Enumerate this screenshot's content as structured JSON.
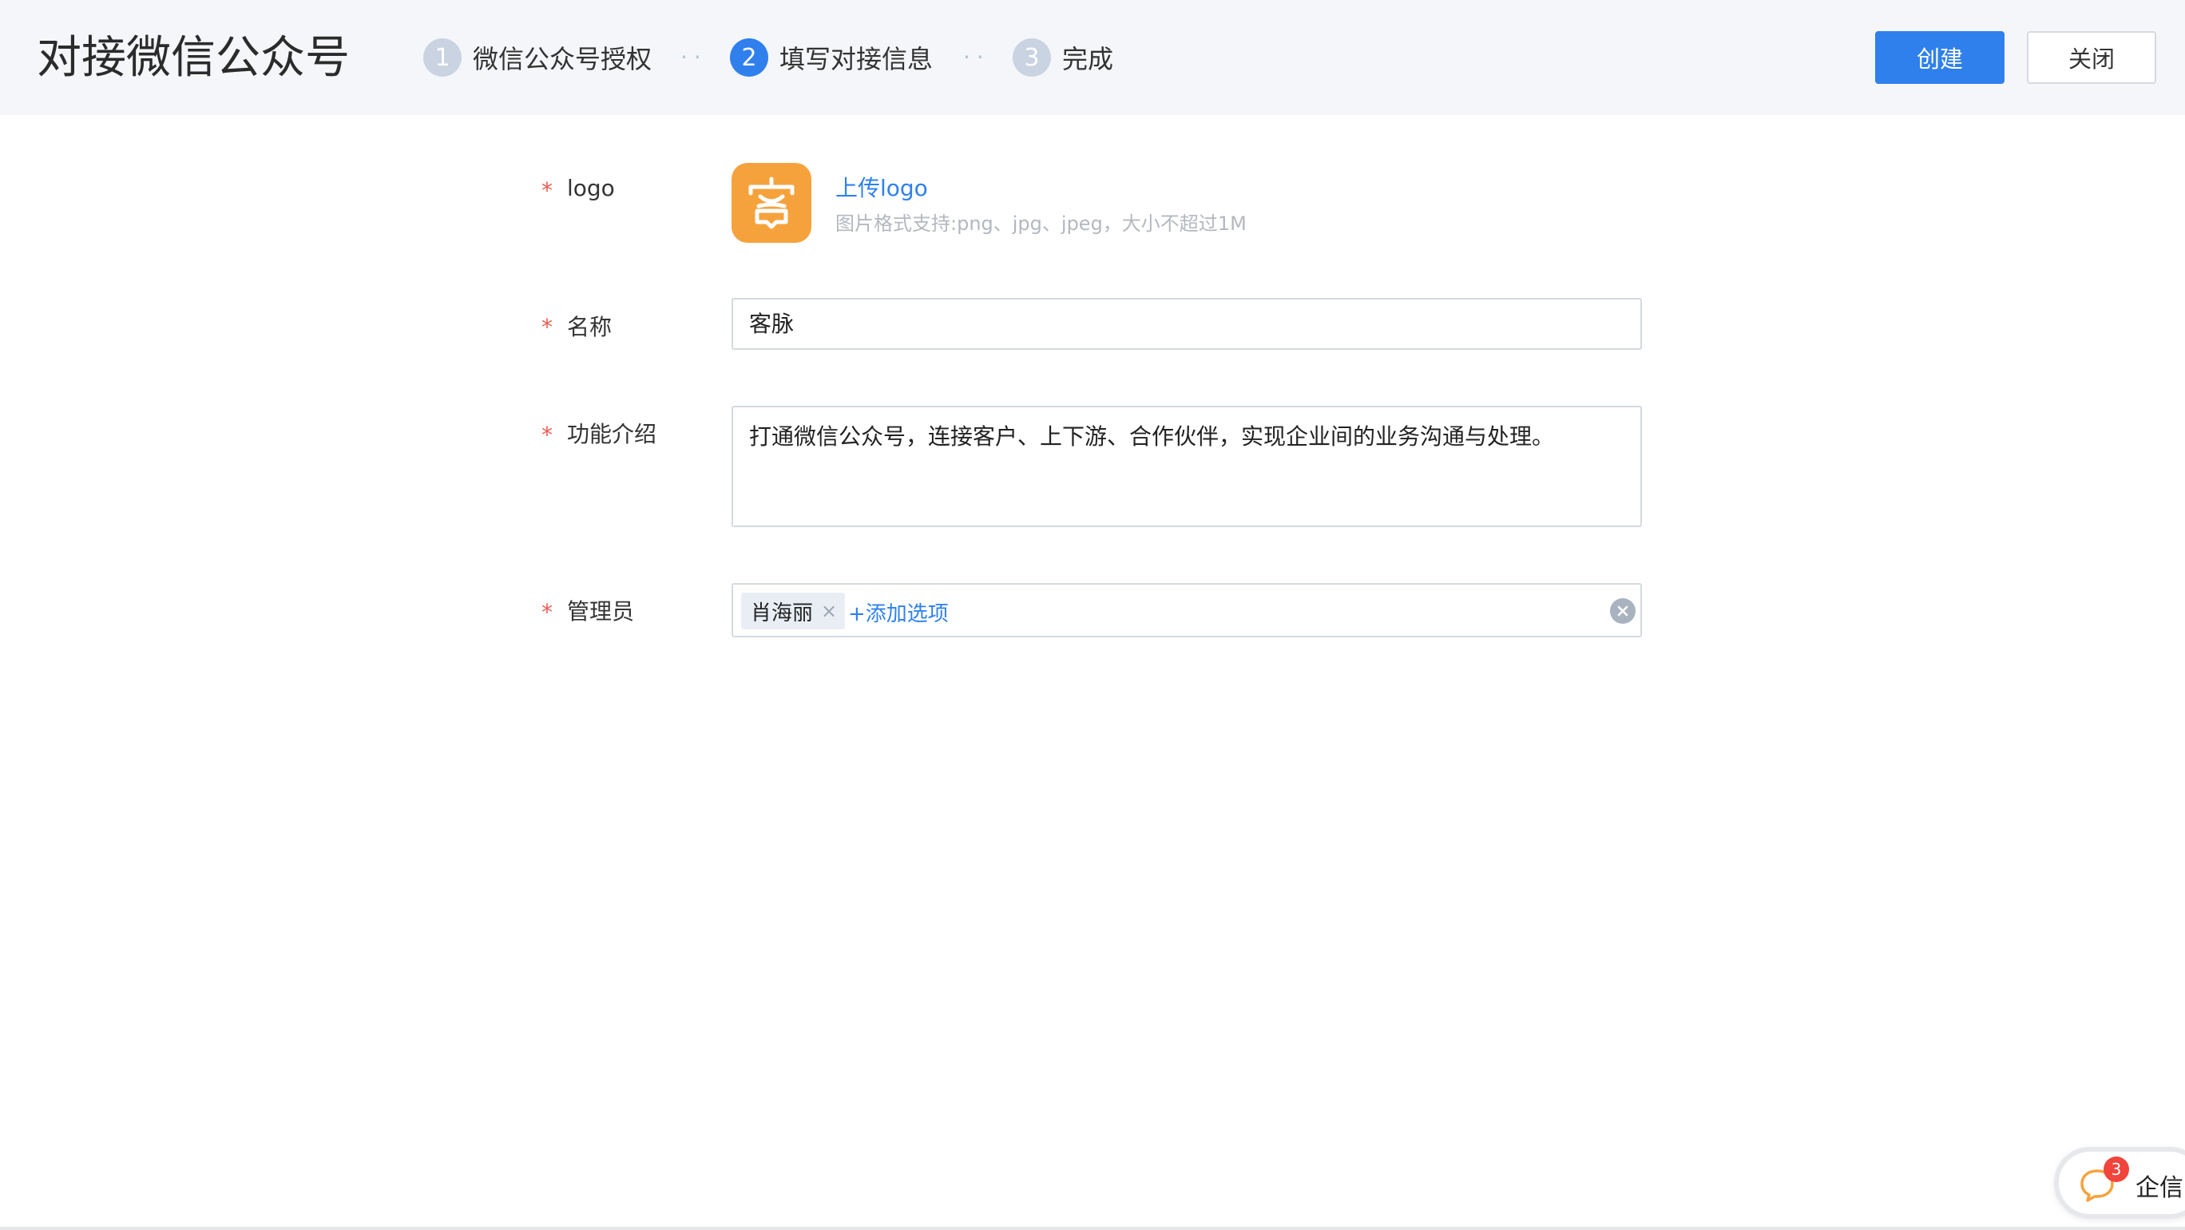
{
  "header": {
    "title": "对接微信公众号",
    "steps": [
      {
        "number": "1",
        "label": "微信公众号授权",
        "state": "done"
      },
      {
        "number": "2",
        "label": "填写对接信息",
        "state": "active"
      },
      {
        "number": "3",
        "label": "完成",
        "state": "todo"
      }
    ],
    "step_separator": "··",
    "create_label": "创建",
    "close_label": "关闭"
  },
  "form": {
    "required_mark": "*",
    "logo": {
      "label": "logo",
      "upload_link": "上传logo",
      "hint": "图片格式支持:png、jpg、jpeg，大小不超过1M",
      "icon": "keimai-logo-icon",
      "color": "#f6a23c"
    },
    "name": {
      "label": "名称",
      "value": "客脉"
    },
    "description": {
      "label": "功能介绍",
      "value": "打通微信公众号，连接客户、上下游、合作伙伴，实现企业间的业务沟通与处理。"
    },
    "admins": {
      "label": "管理员",
      "tags": [
        "肖海丽"
      ],
      "tag_remove": "×",
      "add_option": "+添加选项",
      "clear_icon": "clear-circle-icon"
    }
  },
  "chat_widget": {
    "badge_count": "3",
    "label": "企信",
    "icon": "chat-bubble-icon"
  },
  "colors": {
    "primary": "#2f80ed",
    "header_bg": "#f4f6f9",
    "required": "#ee5a52",
    "badge": "#f0443c"
  }
}
